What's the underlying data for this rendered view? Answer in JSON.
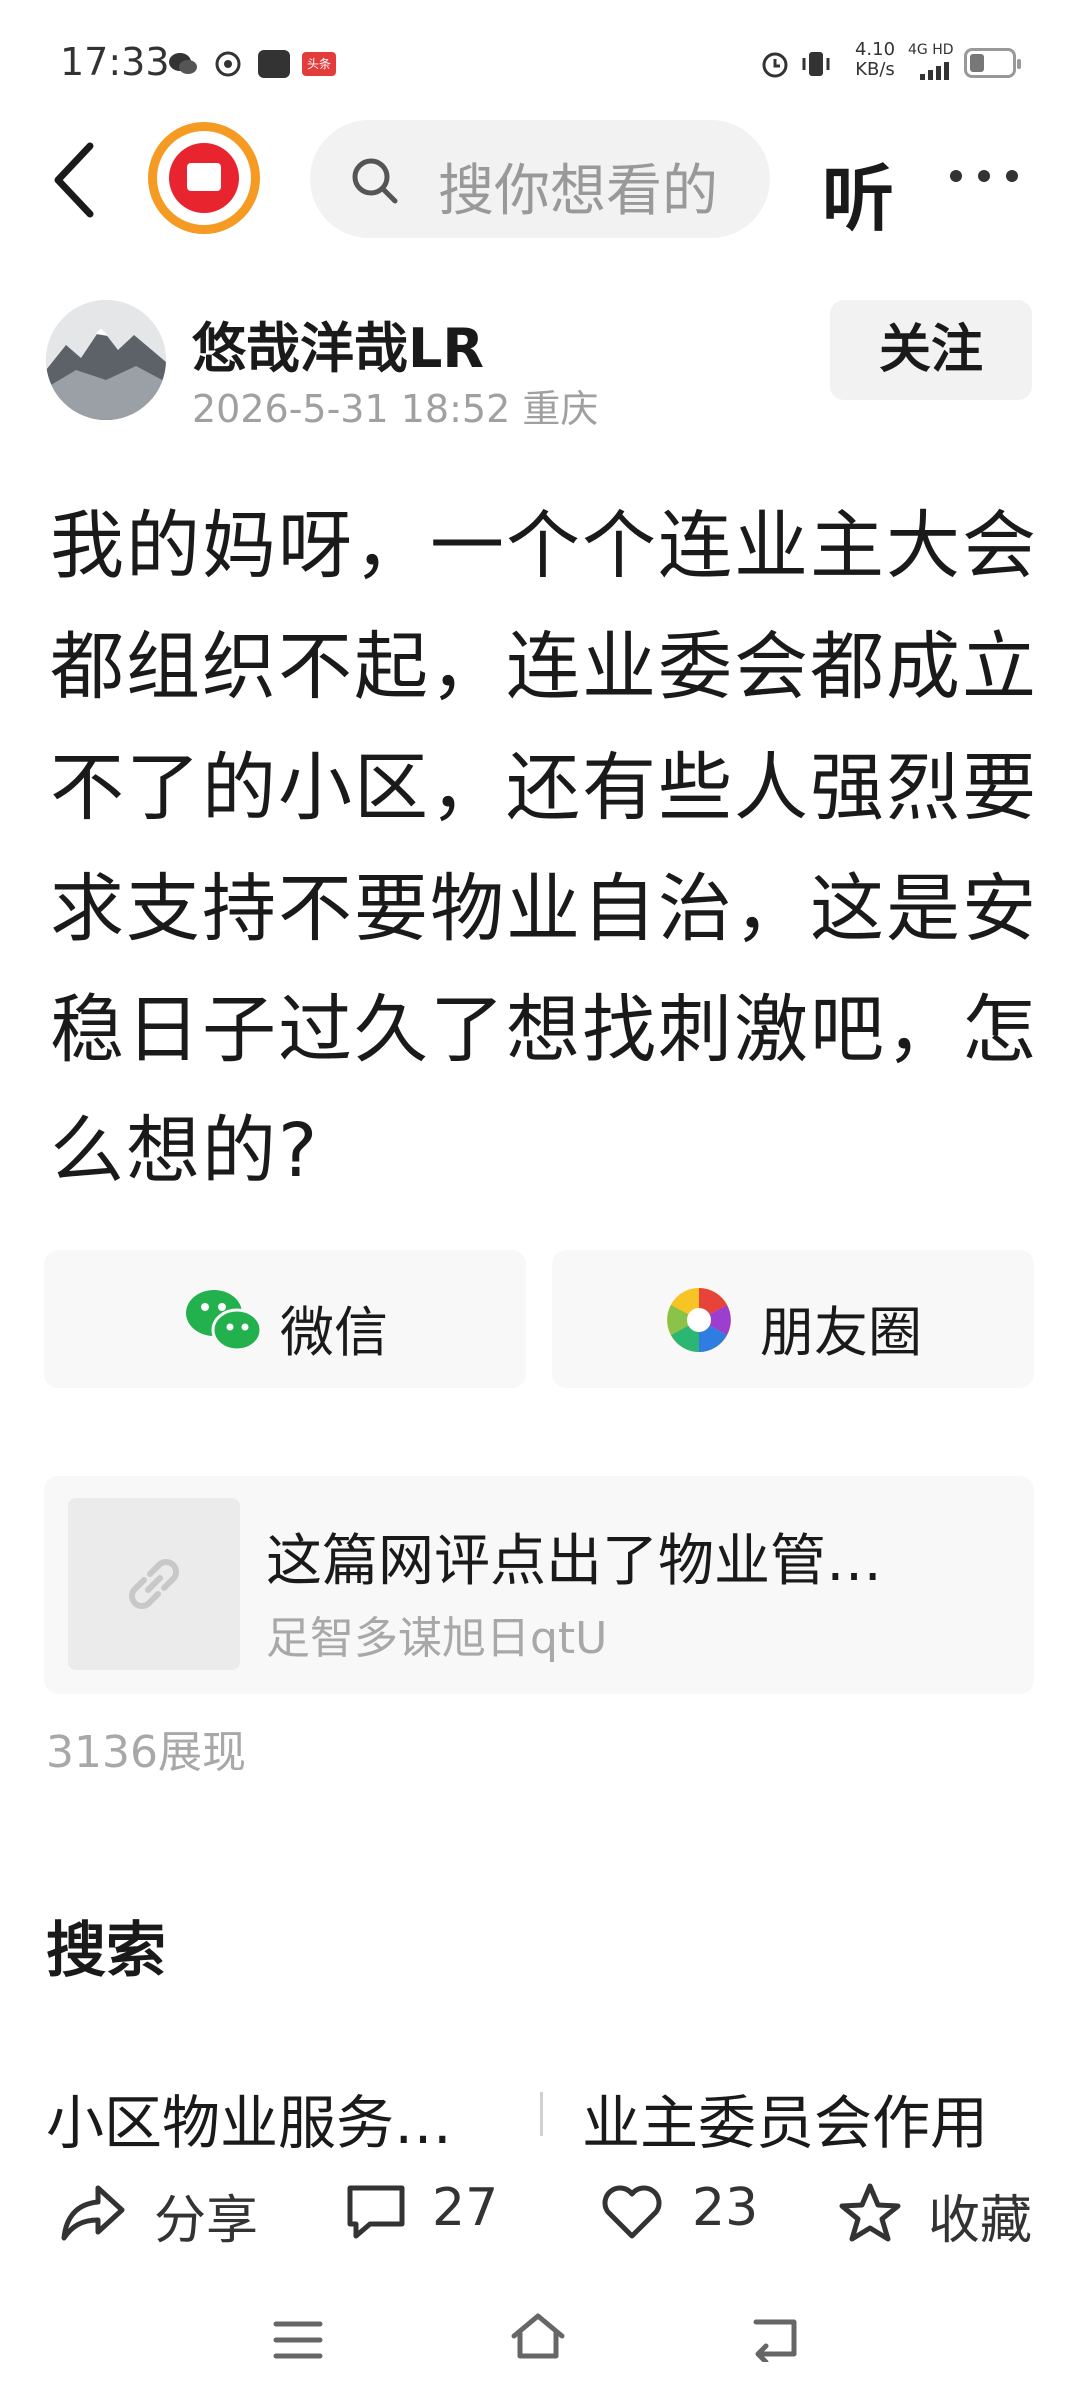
{
  "status_bar": {
    "time": "17:33",
    "net_speed_value": "4.10",
    "net_speed_unit": "KB/s",
    "network_type": "4G HD",
    "toutiao_badge": "头条"
  },
  "header": {
    "search_placeholder": "搜你想看的",
    "listen_label": "听"
  },
  "author": {
    "name": "悠哉洋哉LR",
    "meta": "2026-5-31 18:52  重庆",
    "follow_label": "关注"
  },
  "post": {
    "body": "我的妈呀，一个个连业主大会都组织不起，连业委会都成立不了的小区，还有些人强烈要求支持不要物业自治，这是安稳日子过久了想找刺激吧，怎么想的?"
  },
  "share": {
    "wechat_label": "微信",
    "moments_label": "朋友圈"
  },
  "link_card": {
    "title": "这篇网评点出了物业管…",
    "source": "足智多谋旭日qtU"
  },
  "views": "3136展现",
  "search_section": {
    "title": "搜索",
    "suggestions": [
      "小区物业服务…",
      "业主委员会作用"
    ]
  },
  "actions": {
    "share_label": "分享",
    "comment_count": "27",
    "like_count": "23",
    "favorite_label": "收藏"
  },
  "colors": {
    "accent_orange": "#f59a23",
    "brand_red": "#e8242f",
    "wechat_green": "#22b14c"
  }
}
